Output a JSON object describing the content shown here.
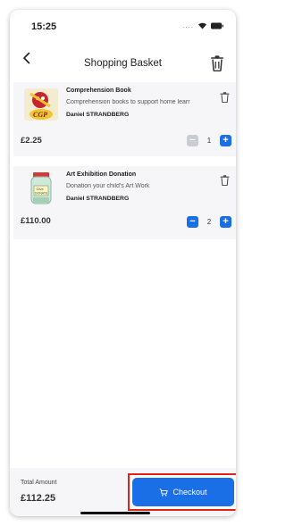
{
  "status_bar": {
    "time": "15:25",
    "dots": "....",
    "icons": [
      "wifi-icon",
      "battery-icon"
    ]
  },
  "header": {
    "title": "Shopping Basket",
    "back_icon": "chevron-left-icon",
    "delete_all_icon": "trash-icon"
  },
  "items": [
    {
      "title": "Comprehension Book",
      "description": "Comprehension books to support home learr",
      "seller": "Daniel STRANDBERG",
      "price": "£2.25",
      "quantity": "1",
      "decrement_enabled": false,
      "image": "book-thumbnail"
    },
    {
      "title": "Art Exhibition Donation",
      "description": "Donation your child's Art Work",
      "seller": "Daniel STRANDBERG",
      "price": "£110.00",
      "quantity": "2",
      "decrement_enabled": true,
      "image": "donation-jar-thumbnail"
    }
  ],
  "footer": {
    "total_label": "Total Amount",
    "total_value": "£112.25",
    "checkout_label": "Checkout",
    "checkout_icon": "cart-icon"
  },
  "colors": {
    "accent": "#1a6fe6",
    "highlight_frame": "#e0231b",
    "card_bg": "#f6f6f8"
  }
}
